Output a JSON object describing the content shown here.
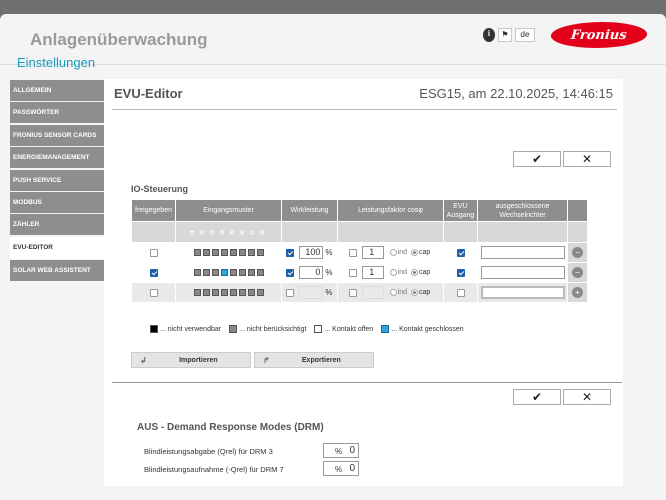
{
  "header": {
    "app_title": "Anlagenüberwachung",
    "info_icon": "info-icon",
    "flag_label": "⚑",
    "lang": "de",
    "logo_text": "Fronius",
    "brand_color": "#e2001a"
  },
  "settings_label": "Einstellungen",
  "nav": {
    "items": [
      {
        "label": "ALLGEMEIN"
      },
      {
        "label": "PASSWÖRTER"
      },
      {
        "label": "FRONIUS SENSOR CARDS"
      },
      {
        "label": "ENERGIEMANAGEMENT"
      },
      {
        "label": "PUSH SERVICE"
      },
      {
        "label": "MODBUS"
      },
      {
        "label": "ZÄHLER"
      },
      {
        "label": "EVU-EDITOR"
      },
      {
        "label": "SOLAR WEB ASSISTENT"
      }
    ],
    "active": "EVU-EDITOR"
  },
  "panel": {
    "title": "EVU-Editor",
    "date": "ESG15, am 22.10.2025, 14:46:15",
    "confirm": "✔",
    "cancel": "✕"
  },
  "io": {
    "section_title": "IO-Steuerung",
    "headers": {
      "freigegeben": "freigegeben",
      "eingangsmuster": "Eingangsmuster",
      "wirkleistung": "Wirkleistung",
      "leistungsfaktor": "Leistungsfaktor cosφ",
      "evu": "EVU Ausgang",
      "ausgeschlossen": "ausgeschlossene Wechselrichter"
    },
    "inputs": [
      "I1",
      "I2",
      "I3",
      "I4",
      "I5",
      "I6",
      "I7",
      "I8"
    ],
    "rows": [
      {
        "enabled": false,
        "pattern": [
          0,
          0,
          0,
          0,
          0,
          0,
          0,
          0
        ],
        "wl_checked": true,
        "wl_value": "100",
        "wl_unit": "%",
        "pf_checked": false,
        "pf_value": "1",
        "ind": "ind",
        "cap": "cap",
        "evu": true,
        "excluded": ""
      },
      {
        "enabled": true,
        "pattern": [
          0,
          0,
          0,
          1,
          0,
          0,
          0,
          0
        ],
        "wl_checked": true,
        "wl_value": "0",
        "wl_unit": "%",
        "pf_checked": false,
        "pf_value": "1",
        "ind": "ind",
        "cap": "cap",
        "evu": true,
        "excluded": ""
      },
      {
        "enabled": false,
        "pattern": [
          0,
          0,
          0,
          0,
          0,
          0,
          0,
          0
        ],
        "wl_checked": false,
        "wl_value": "",
        "wl_unit": "%",
        "pf_checked": false,
        "pf_value": "",
        "ind": "ind",
        "cap": "cap",
        "evu": false,
        "excluded": ""
      }
    ],
    "row_actions": [
      "−",
      "−",
      "+"
    ]
  },
  "legend": [
    {
      "label": "... nicht verwendbar",
      "color": "#000000"
    },
    {
      "label": "... nicht berücksichtigt",
      "color": "#888888"
    },
    {
      "label": "... Kontakt offen",
      "color": "#ffffff"
    },
    {
      "label": "... Kontakt geschlossen",
      "color": "#2ba5dc"
    }
  ],
  "actions": {
    "import_label": "Importieren",
    "export_label": "Exportieren"
  },
  "drm": {
    "title": "AUS - Demand Response Modes (DRM)",
    "row1_label": "Blindleistungsabgabe (Qrel) für DRM 3",
    "row1_value": "0",
    "row2_label": "Blindleistungsaufnahme (-Qrel) für DRM 7",
    "row2_value": "0",
    "unit": "%"
  }
}
